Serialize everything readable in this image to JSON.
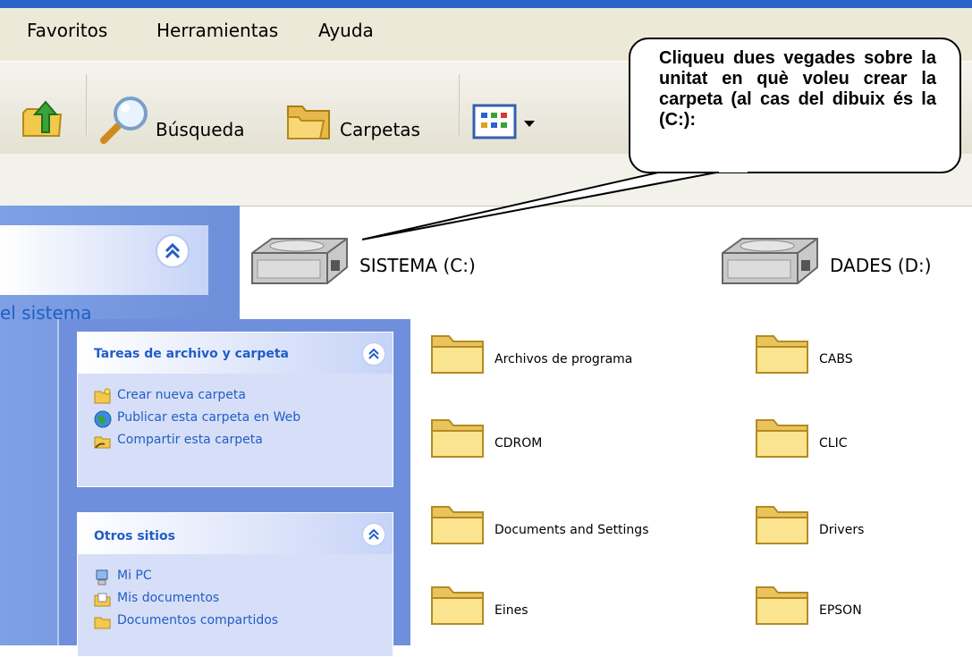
{
  "menu": {
    "favoritos": "Favoritos",
    "herramientas": "Herramientas",
    "ayuda": "Ayuda"
  },
  "toolbar": {
    "search_label": "Búsqueda",
    "folders_label": "Carpetas"
  },
  "left_pane_back": {
    "partial_text": "el sistema"
  },
  "task_panel": {
    "file_tasks": {
      "title": "Tareas de archivo y carpeta",
      "links": [
        "Crear nueva carpeta",
        "Publicar esta carpeta en Web",
        "Compartir esta carpeta"
      ]
    },
    "other_places": {
      "title": "Otros sitios",
      "links": [
        "Mi PC",
        "Mis documentos",
        "Documentos compartidos"
      ]
    }
  },
  "drives": [
    "SISTEMA (C:)",
    "DADES (D:)"
  ],
  "folders": {
    "column1": [
      "Archivos de programa",
      "CDROM",
      "Documents and Settings",
      "Eines"
    ],
    "column2": [
      "CABS",
      "CLIC",
      "Drivers",
      "EPSON"
    ]
  },
  "callout": {
    "text": "Cliqueu dues vegades sobre la unitat en què voleu crear la carpeta (al cas del dibuix és la (C:):"
  },
  "colors": {
    "link_blue": "#215dc6",
    "xp_blue": "#2a63c9",
    "toolbar_beige": "#ece9d8",
    "task_pane_blue": "#6f8fdc"
  }
}
